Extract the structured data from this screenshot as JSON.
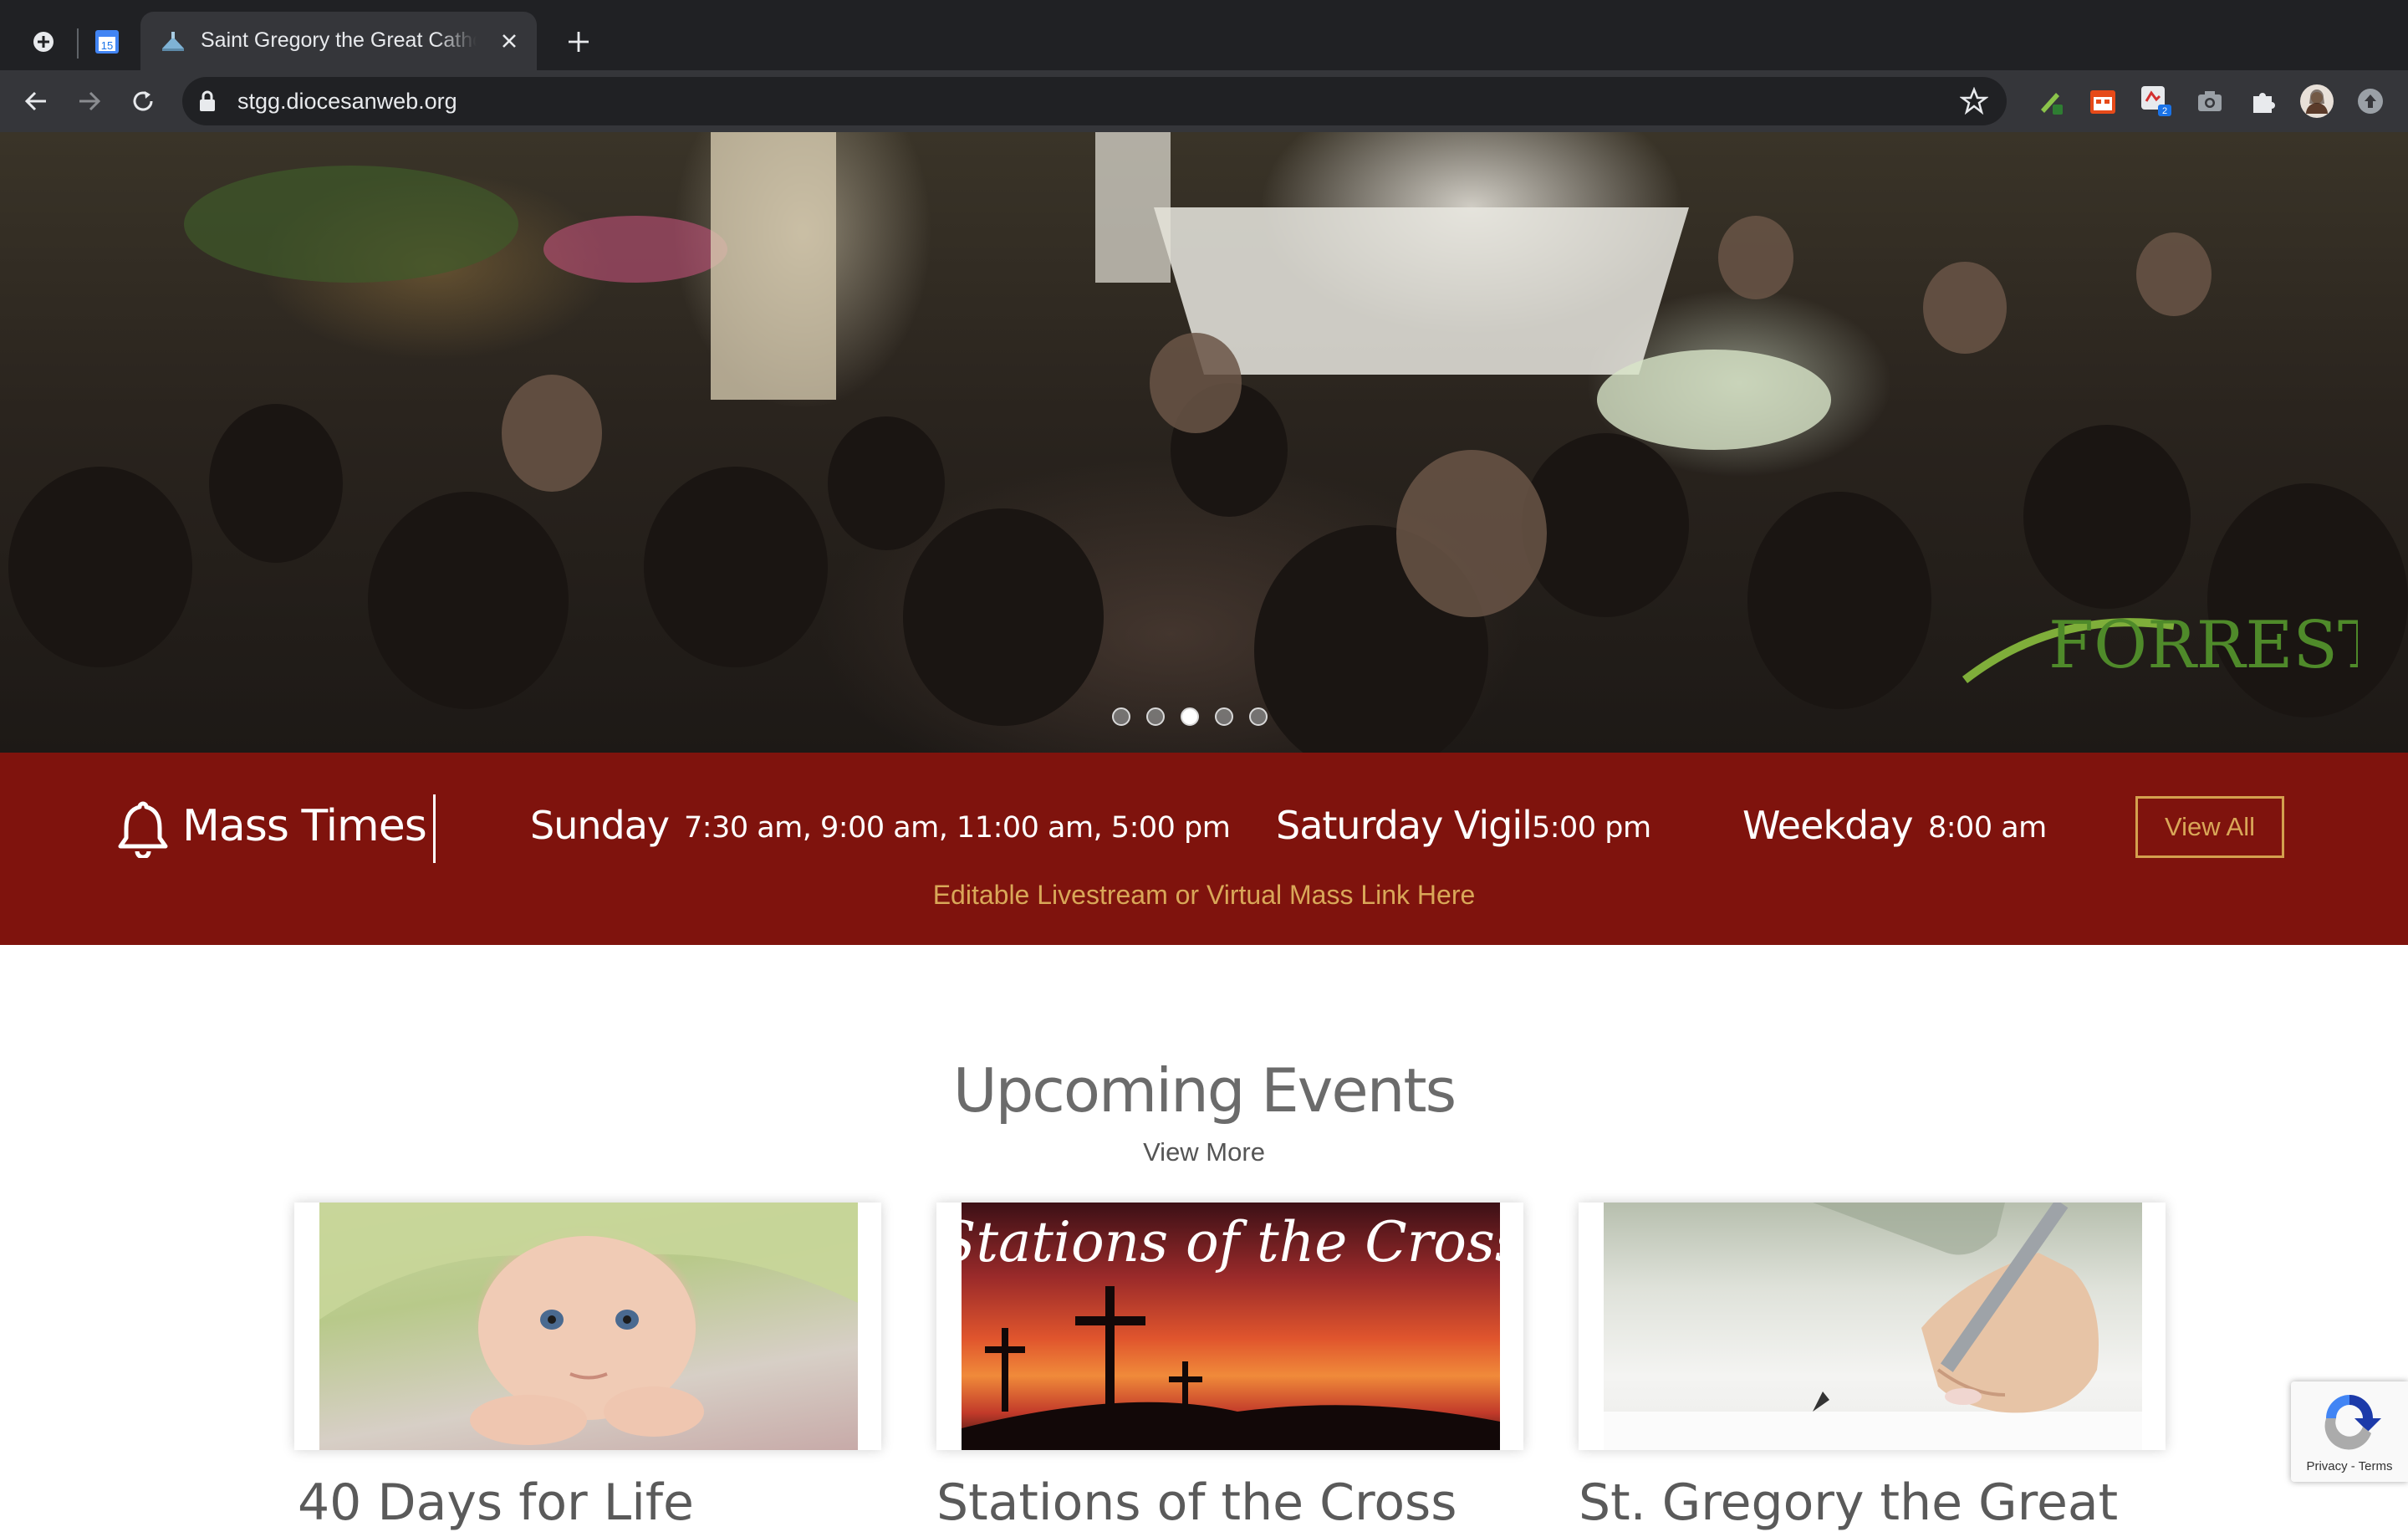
{
  "browser": {
    "tab_title": "Saint Gregory the Great Catholic",
    "calendar_day": "15",
    "url": "stgg.diocesanweb.org",
    "extension_badge": "2"
  },
  "hero": {
    "watermark": "FORREST",
    "slide_count": 5,
    "active_slide": 3
  },
  "mass_times": {
    "title": "Mass Times",
    "sunday_label": "Sunday",
    "sunday_times": "7:30 am, 9:00 am, 11:00 am, 5:00 pm",
    "saturday_label": "Saturday Vigil",
    "saturday_times": "5:00 pm",
    "weekday_label": "Weekday",
    "weekday_times": "8:00 am",
    "view_all": "View All",
    "livestream_link": "Editable Livestream or Virtual Mass Link Here"
  },
  "events": {
    "heading": "Upcoming Events",
    "view_more": "View More",
    "cards": [
      {
        "title": "40 Days for Life"
      },
      {
        "title": "Stations of the Cross",
        "image_caption": "Stations of the Cross"
      },
      {
        "title": "St. Gregory the Great"
      }
    ]
  },
  "recaptcha": {
    "links": "Privacy - Terms"
  },
  "colors": {
    "mass_band": "#7f130d",
    "accent_gold": "#d9a758",
    "chrome_dark": "#202124",
    "chrome_mid": "#35363a"
  }
}
